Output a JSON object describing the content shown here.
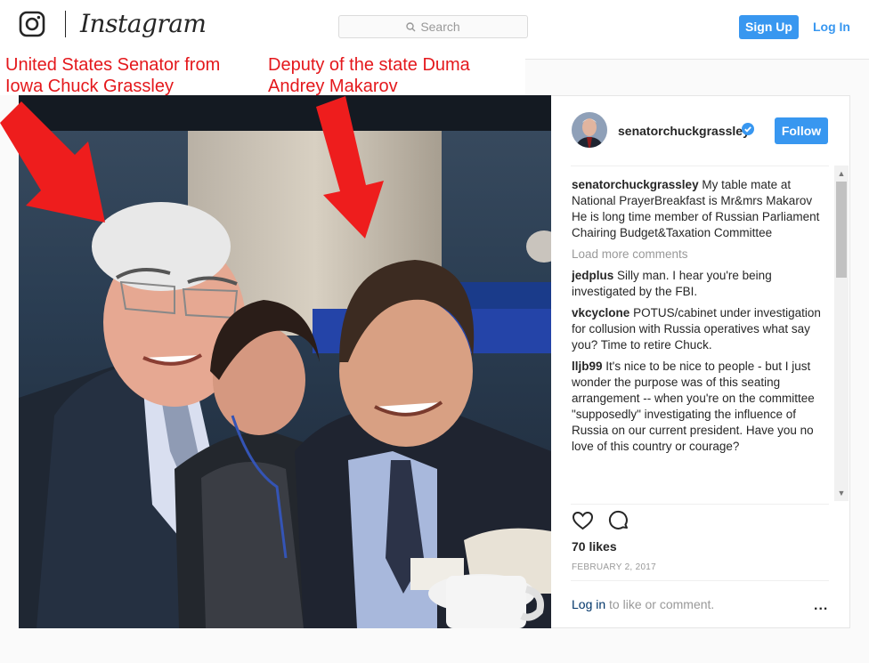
{
  "app": {
    "name": "Instagram"
  },
  "search": {
    "placeholder": "Search"
  },
  "header": {
    "signup_label": "Sign Up",
    "login_label": "Log In"
  },
  "annotations": {
    "left": [
      "United States Senator from",
      "Iowa Chuck Grassley"
    ],
    "right": [
      "Deputy of the state Duma",
      "Andrey Makarov"
    ]
  },
  "post": {
    "username": "senatorchuckgrassley",
    "follow_label": "Follow",
    "caption": "My table mate at National PrayerBreakfast is Mr&mrs Makarov He is long time member of Russian Parliament Chairing Budget&Taxation Committee",
    "load_more": "Load more comments",
    "comments": [
      {
        "user": "jedplus",
        "text": "Silly man. I hear you're being investigated by the FBI."
      },
      {
        "user": "vkcyclone",
        "text": "POTUS/cabinet under investigation for collusion with Russia operatives what say you? Time to retire Chuck."
      },
      {
        "user": "lljb99",
        "text": "It's nice to be nice to people - but I just wonder the purpose was of this seating arrangement -- when you're on the committee \"supposedly\" investigating the influence of Russia on our current president. Have you no love of this country or courage?"
      }
    ],
    "likes": "70 likes",
    "date": "FEBRUARY 2, 2017",
    "login_link": "Log in",
    "login_rest": " to like or comment.",
    "more_label": "..."
  },
  "colors": {
    "accent": "#3897f0",
    "annotation": "#e4181c"
  }
}
